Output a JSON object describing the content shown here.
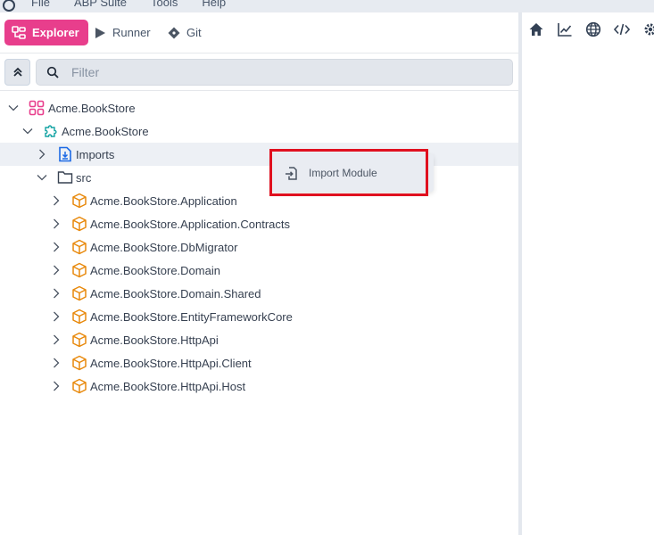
{
  "menubar": {
    "items": [
      "File",
      "ABP Suite",
      "Tools",
      "Help"
    ]
  },
  "toolbar": {
    "explorer_label": "Explorer",
    "runner_label": "Runner",
    "git_label": "Git"
  },
  "filter": {
    "placeholder": "Filter"
  },
  "tree": {
    "solution": "Acme.BookStore",
    "module": "Acme.BookStore",
    "imports": "Imports",
    "src": "src",
    "projects": [
      "Acme.BookStore.Application",
      "Acme.BookStore.Application.Contracts",
      "Acme.BookStore.DbMigrator",
      "Acme.BookStore.Domain",
      "Acme.BookStore.Domain.Shared",
      "Acme.BookStore.EntityFrameworkCore",
      "Acme.BookStore.HttpApi",
      "Acme.BookStore.HttpApi.Client",
      "Acme.BookStore.HttpApi.Host"
    ]
  },
  "context_menu": {
    "import_module_label": "Import Module"
  },
  "right_toolbar": {
    "icons": [
      "home-icon",
      "chart-icon",
      "globe-icon",
      "code-icon",
      "gear-icon"
    ]
  },
  "colors": {
    "accent": "#e83e8c",
    "project_icon": "#e8890c",
    "imports_icon": "#1d6ae5",
    "highlight_outline": "#e0101f"
  }
}
